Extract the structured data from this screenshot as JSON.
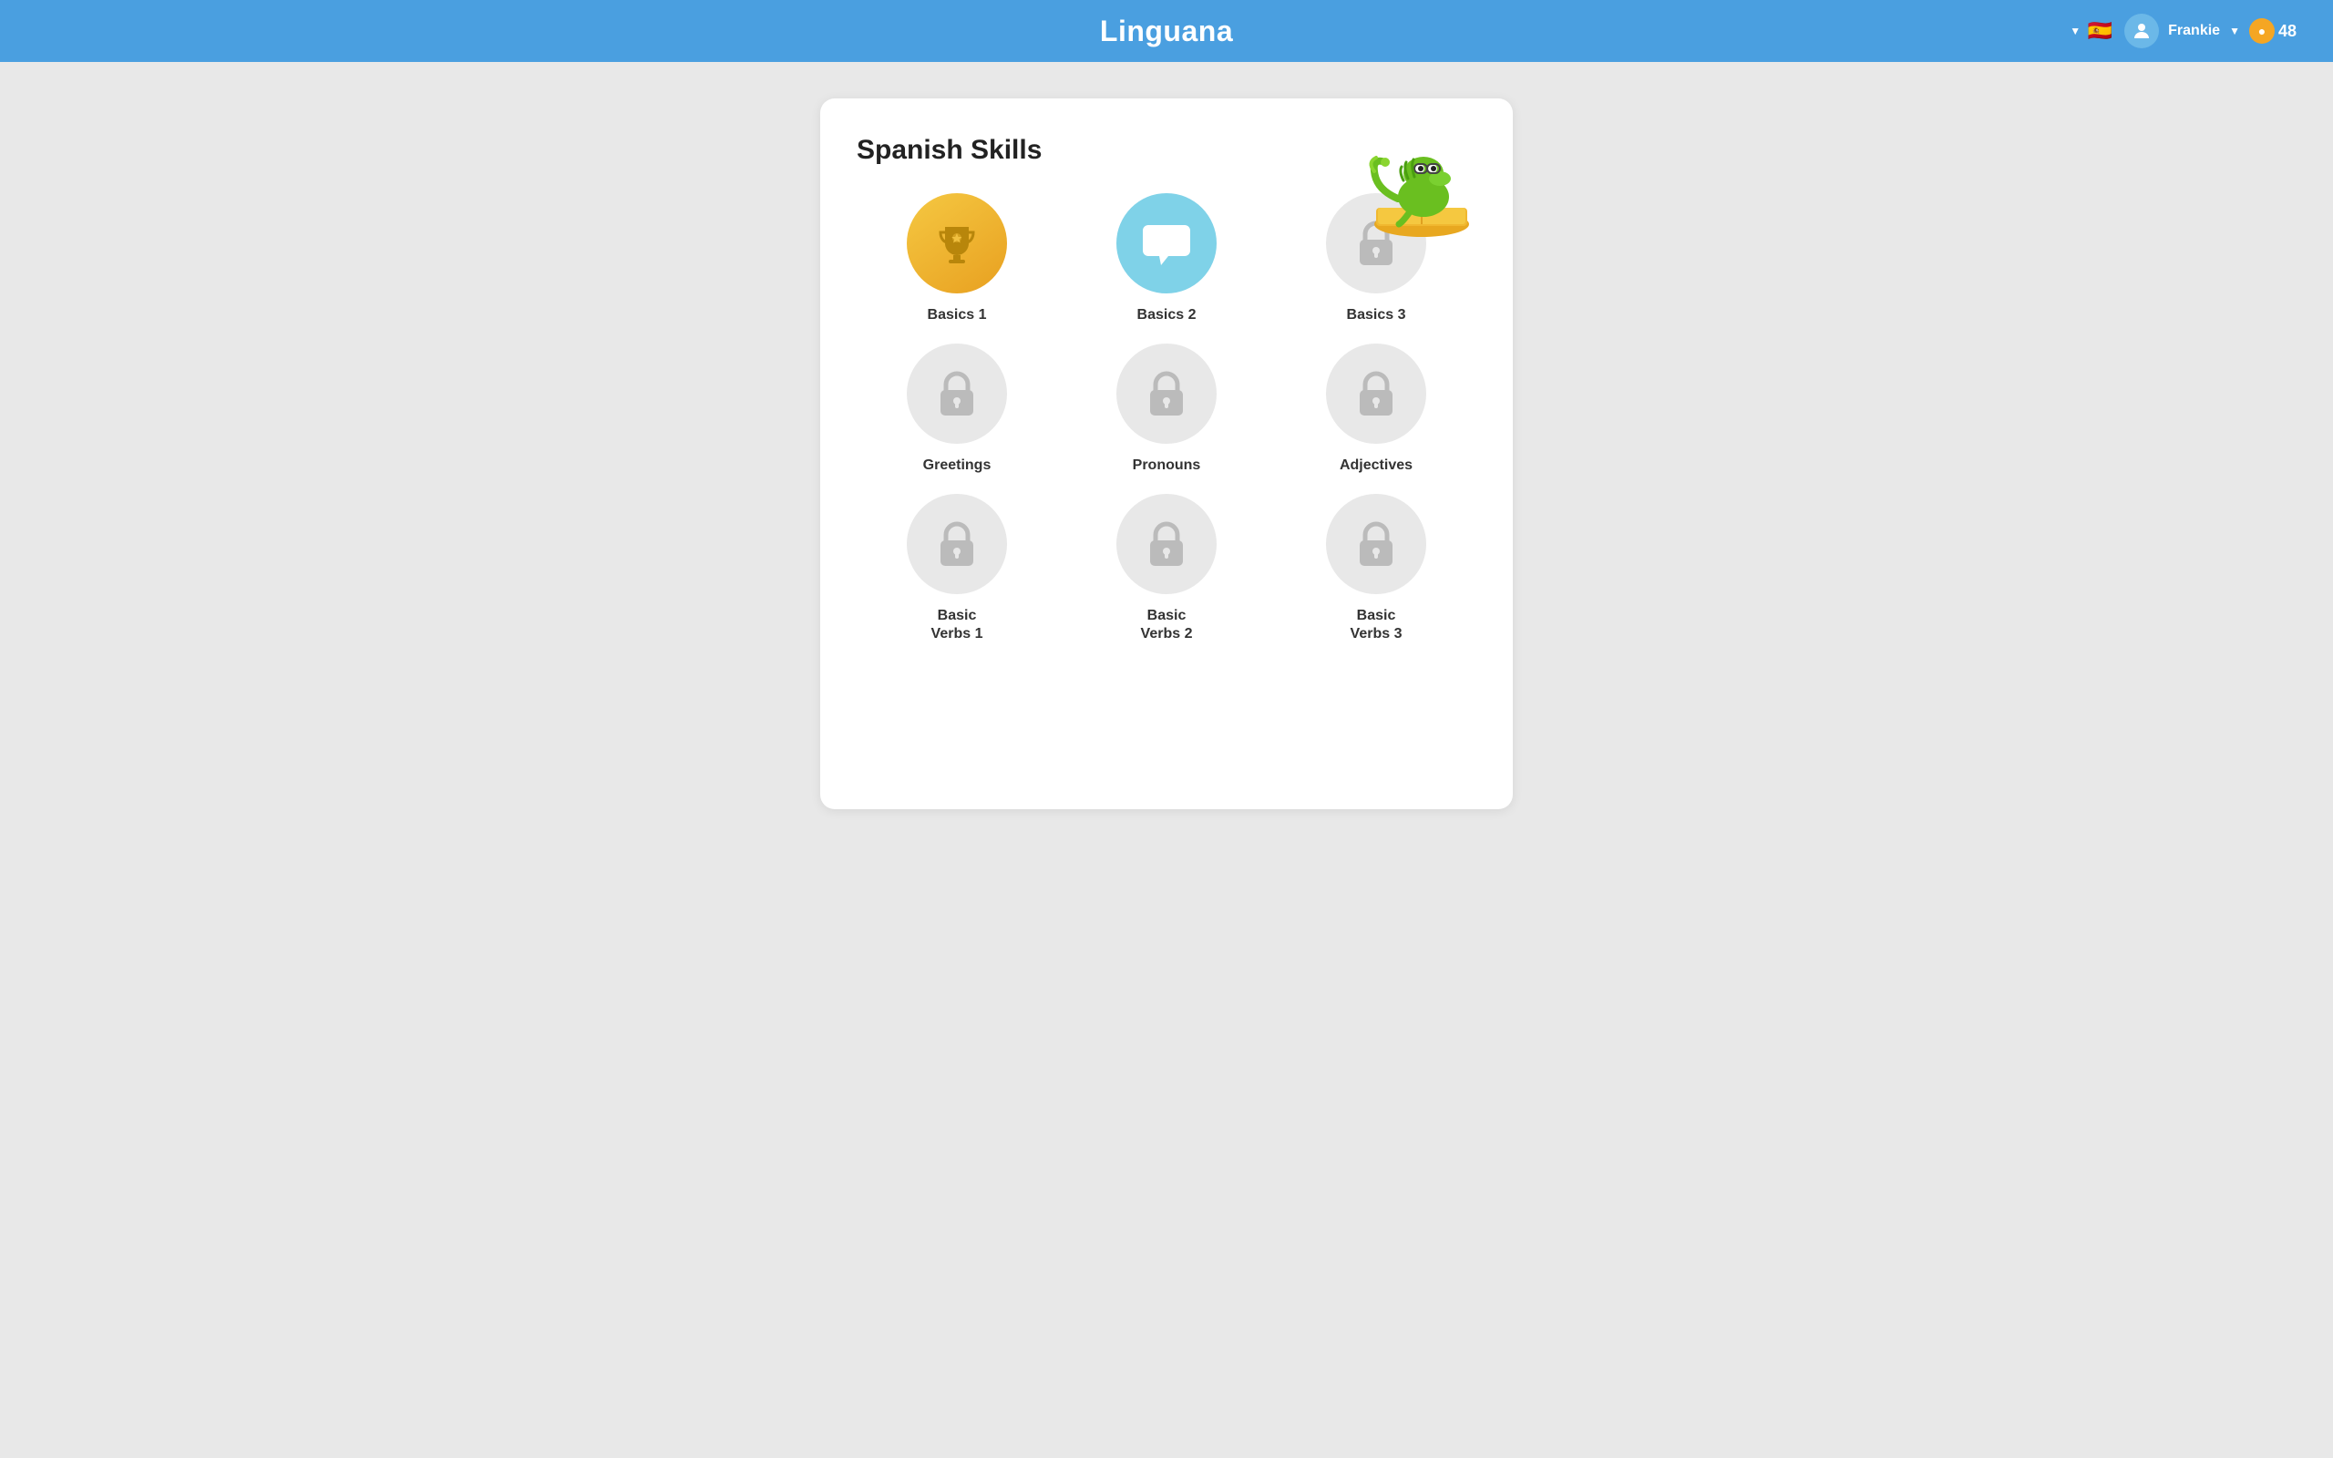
{
  "header": {
    "title": "Linguana",
    "user": {
      "name": "Frankie",
      "coins": "48"
    },
    "language": "🇪🇸"
  },
  "page": {
    "title": "Spanish Skills"
  },
  "skills": [
    {
      "id": "basics-1",
      "label": "Basics 1",
      "state": "completed",
      "icon": "trophy"
    },
    {
      "id": "basics-2",
      "label": "Basics 2",
      "state": "current",
      "icon": "chat"
    },
    {
      "id": "basics-3",
      "label": "Basics 3",
      "state": "locked",
      "icon": "lock"
    },
    {
      "id": "greetings",
      "label": "Greetings",
      "state": "locked",
      "icon": "lock"
    },
    {
      "id": "pronouns",
      "label": "Pronouns",
      "state": "locked",
      "icon": "lock"
    },
    {
      "id": "adjectives",
      "label": "Adjectives",
      "state": "locked",
      "icon": "lock"
    },
    {
      "id": "basic-verbs-1",
      "label": "Basic\nVerbs 1",
      "state": "locked",
      "icon": "lock"
    },
    {
      "id": "basic-verbs-2",
      "label": "Basic\nVerbs 2",
      "state": "locked",
      "icon": "lock"
    },
    {
      "id": "basic-verbs-3",
      "label": "Basic\nVerbs 3",
      "state": "locked",
      "icon": "lock"
    }
  ]
}
